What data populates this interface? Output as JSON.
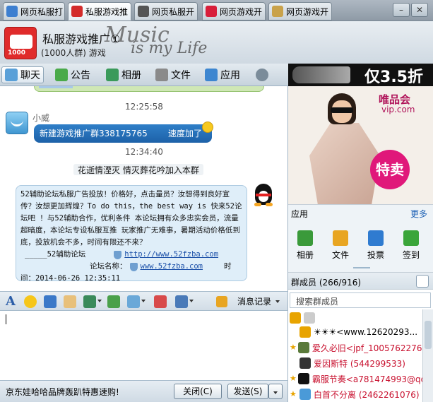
{
  "tabs": [
    {
      "label": "网页私服打",
      "color": "#3d7fd0"
    },
    {
      "label": "私服游戏推",
      "color": "#d32b2b"
    },
    {
      "label": "网页私服开",
      "color": "#555555"
    },
    {
      "label": "网页游戏开",
      "color": "#d81e3a"
    },
    {
      "label": "网页游戏开",
      "color": "#c9a24a"
    }
  ],
  "window": {
    "minimize": "–",
    "close": "✕"
  },
  "group": {
    "name": "私服游戏推广①",
    "count": "(1000人群) 游戏",
    "avatar_num": "1000"
  },
  "skin": {
    "word1": "Music",
    "word2": "is my Life"
  },
  "toolbar": {
    "chat": "聊天",
    "notice": "公告",
    "album": "相册",
    "files": "文件",
    "apps": "应用"
  },
  "top_ad": {
    "price": "仅3.5折"
  },
  "chat": {
    "ts1": "12:25:58",
    "sender": "小威",
    "msg1_left": "新建游戏推广群338175765",
    "msg1_right": "速度加了",
    "ts2": "12:34:40",
    "system": "花逝情湮灭 情灭葬花吟加入本群",
    "ad_text": "52辅助论坛私服广告投放！价格好，点击量员？汝想得到良好宣传？汝想更加辉煌？To do this，the best way is 快来52论坛吧 ！与52辅助合作，优利条件 本论坛拥有众多忠实会员，流量超暗度，本论坛专设私服互推 玩家推广无难事，暑期活动价格低到底，投放机会不多，时间有限还不来？",
    "sig_name": "_____52辅助论坛",
    "link1": "http://www.52fzba.com",
    "site_label": "论坛名称：",
    "link2": "www.52fzba.com",
    "time_label": "时",
    "time_value": "间：2014-06-26 12:35:11"
  },
  "inbar": {
    "msglog": "消息记录"
  },
  "bottom": {
    "promo": "京东娃哈哈品牌轰趴特惠速购!",
    "close": "关闭(C)",
    "send": "发送(S)"
  },
  "vip": {
    "logo": "唯品会",
    "url": "vip.com",
    "sale": "特卖"
  },
  "apps": {
    "title": "应用",
    "more": "更多",
    "items": [
      {
        "label": "相册",
        "color": "#3a9a3a"
      },
      {
        "label": "文件",
        "color": "#e8a522"
      },
      {
        "label": "投票",
        "color": "#2f7bd0"
      },
      {
        "label": "签到",
        "color": "#3aa53a"
      }
    ]
  },
  "members": {
    "header": "群成员 (266/916)",
    "search_placeholder": "搜索群成员",
    "rows": [
      {
        "name": "",
        "color": "#999999",
        "star": false,
        "red": false
      },
      {
        "name": "☀☀☀<www.12620293...",
        "color": "#e8a400",
        "star": false,
        "red": false
      },
      {
        "name": "爱久必旧<jpf_1005762276...",
        "color": "#5a7a3a",
        "star": true,
        "red": true
      },
      {
        "name": "爱因斯特 (544299533)",
        "color": "#333333",
        "star": false,
        "red": true
      },
      {
        "name": "霸服节奏<a781474993@qq...",
        "color": "#111111",
        "star": true,
        "red": true
      },
      {
        "name": "白首不分离 (2462261076)",
        "color": "#4a9ad8",
        "star": true,
        "red": true
      }
    ]
  },
  "colors": {
    "chat_bg": "#ffffff",
    "blue_bubble": "#2f7fc8",
    "ad_bubble": "#dfeef9"
  }
}
